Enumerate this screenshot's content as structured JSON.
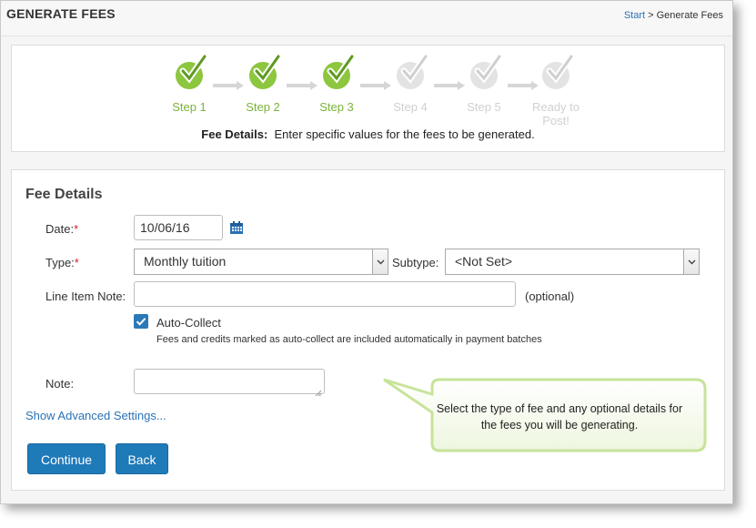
{
  "header": {
    "title": "GENERATE FEES",
    "breadcrumb_start": "Start",
    "breadcrumb_separator": ">",
    "breadcrumb_current": "Generate Fees"
  },
  "steps": [
    {
      "label": "Step 1",
      "done": true
    },
    {
      "label": "Step 2",
      "done": true
    },
    {
      "label": "Step 3",
      "done": true
    },
    {
      "label": "Step 4",
      "done": false
    },
    {
      "label": "Step 5",
      "done": false
    },
    {
      "label": "Ready to Post!",
      "done": false
    }
  ],
  "step_description": {
    "title": "Fee Details:",
    "text": "Enter specific values for the fees to be generated."
  },
  "form": {
    "section_title": "Fee Details",
    "date_label": "Date:",
    "date_value": "10/06/16",
    "type_label": "Type:",
    "type_value": "Monthly tuition",
    "subtype_label": "Subtype:",
    "subtype_value": "<Not Set>",
    "line_item_label": "Line Item Note:",
    "line_item_value": "",
    "optional_text": "(optional)",
    "auto_collect_label": "Auto-Collect",
    "auto_collect_checked": true,
    "auto_collect_help": "Fees and credits marked as auto-collect are included automatically in payment batches",
    "note_label": "Note:",
    "note_value": "",
    "required_marker": "*",
    "advanced_link": "Show Advanced Settings...",
    "continue_label": "Continue",
    "back_label": "Back"
  },
  "callout": {
    "text": "Select the type of fee and any optional details for the fees you will be generating."
  },
  "colors": {
    "step_done": "#8dc63f",
    "step_todo": "#e3e3e3",
    "link": "#2a72b5",
    "button": "#1f7ab8",
    "callout_border": "#c7e39a"
  }
}
